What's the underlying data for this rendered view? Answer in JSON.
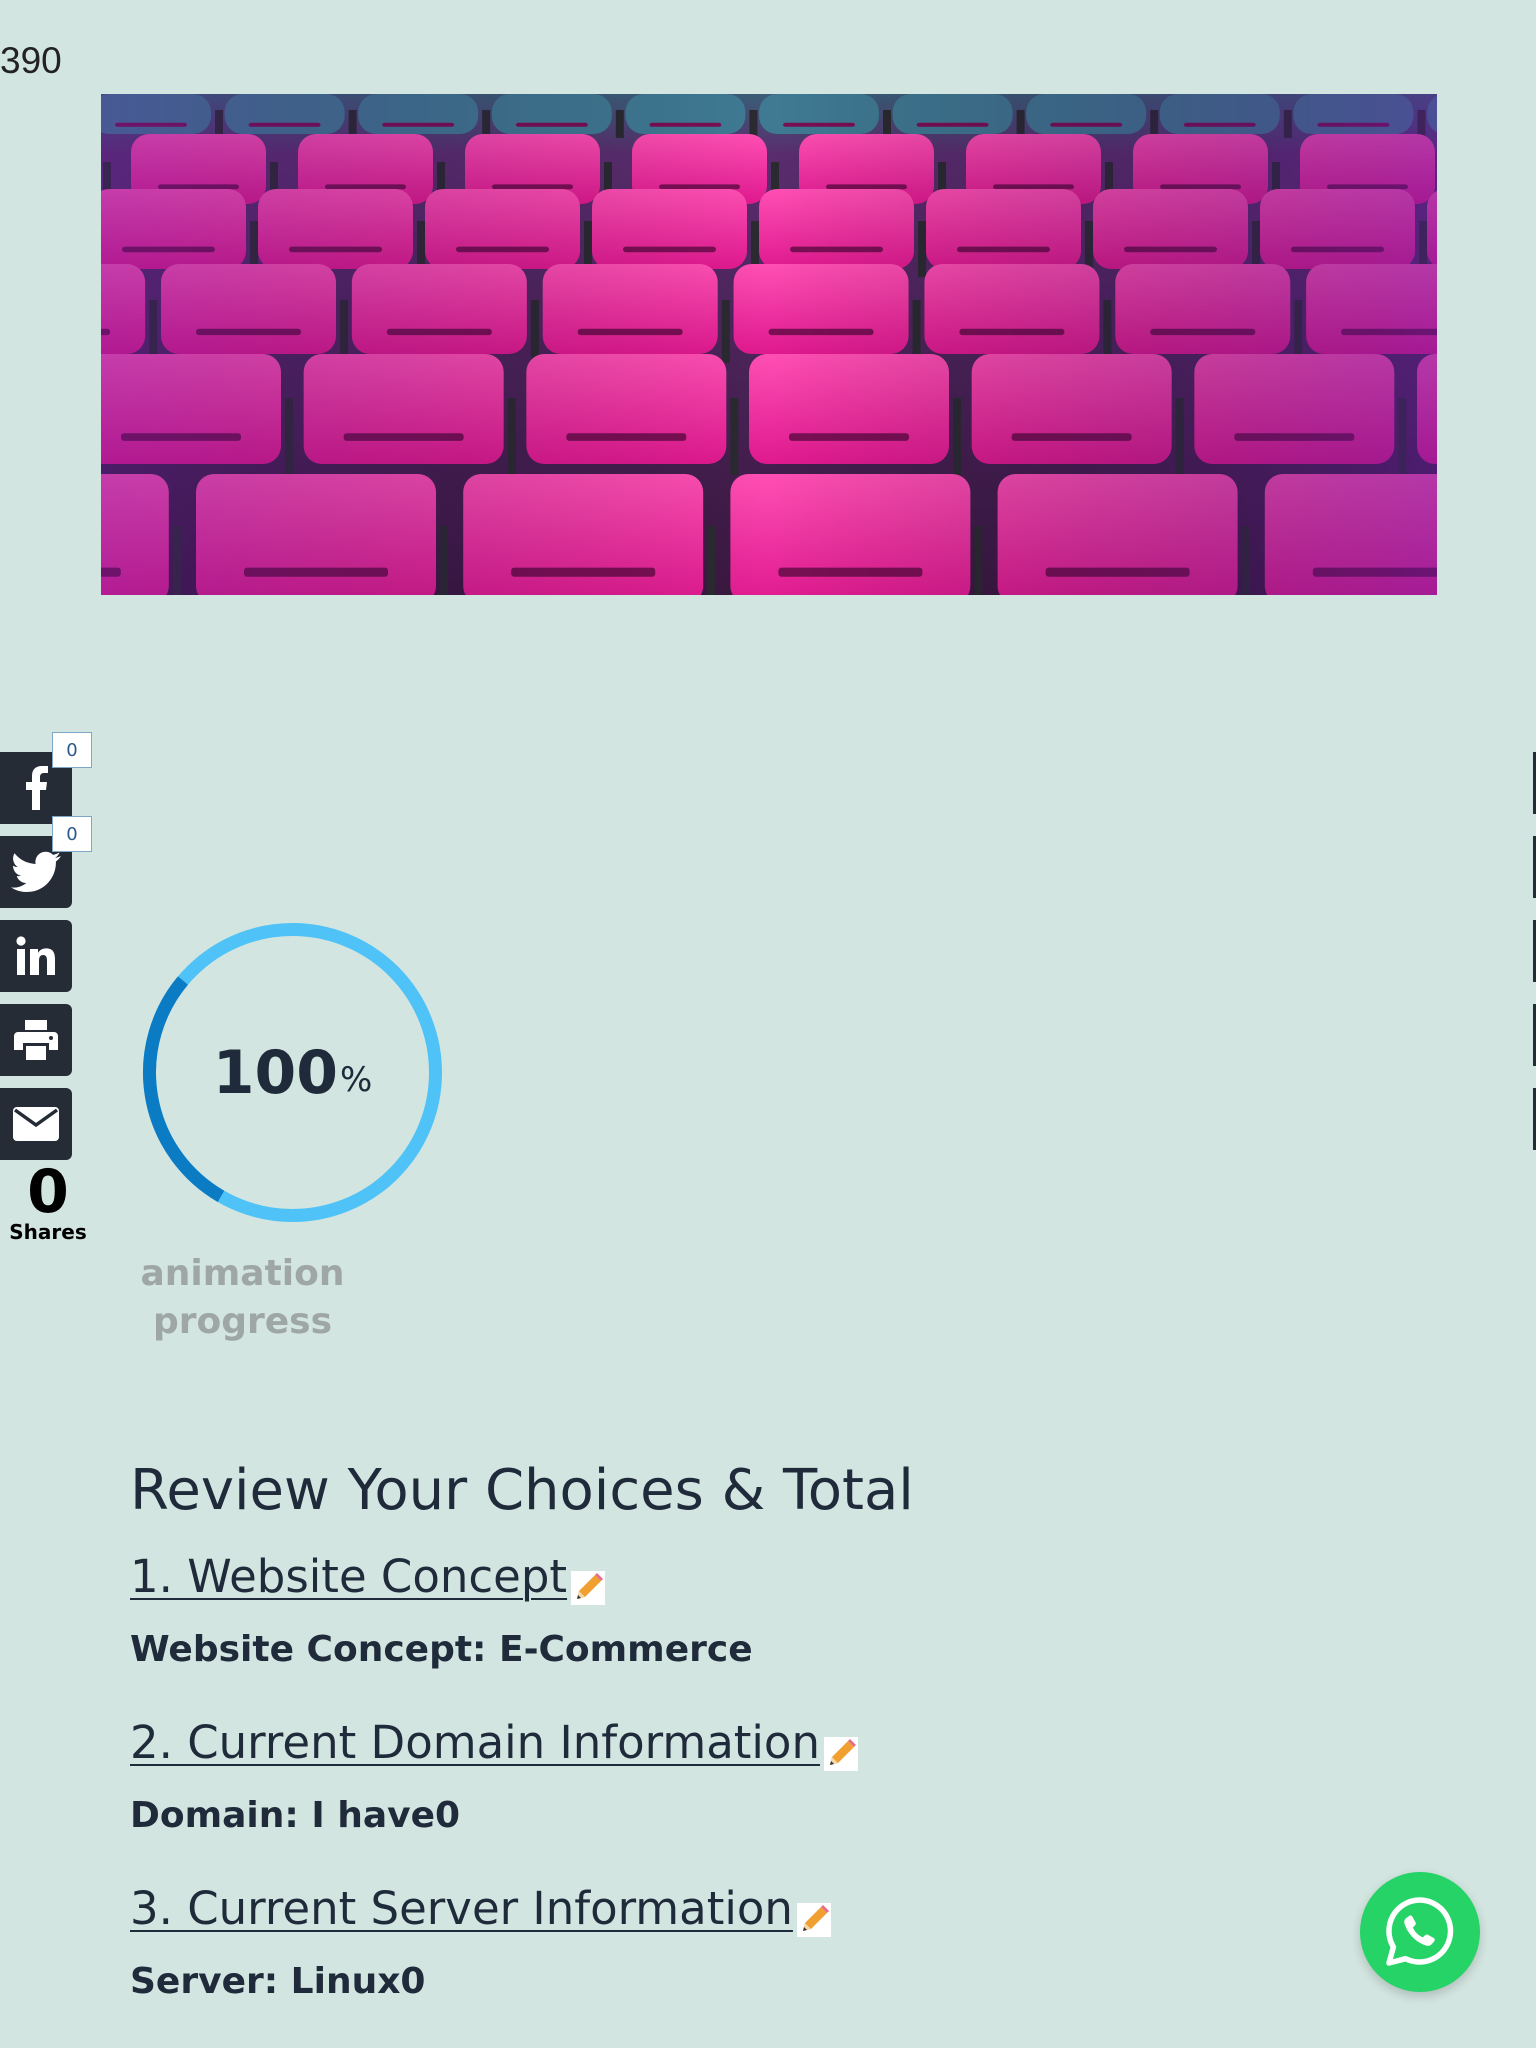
{
  "counter": "390",
  "hero": {
    "image": "pink-stadium-seats-photo"
  },
  "share": {
    "facebook": {
      "icon": "facebook-icon",
      "count": "0"
    },
    "twitter": {
      "icon": "twitter-icon",
      "count": "0"
    },
    "linkedin": {
      "icon": "linkedin-icon"
    },
    "print": {
      "icon": "print-icon"
    },
    "email": {
      "icon": "email-icon"
    },
    "total": "0",
    "total_label": "Shares"
  },
  "progress": {
    "value": "100",
    "unit": "%",
    "caption_line1": "animation",
    "caption_line2": "progress",
    "colors": {
      "light": "#4fc3f7",
      "dark": "#0b7bc4"
    }
  },
  "review": {
    "title": "Review Your Choices & Total",
    "steps": [
      {
        "title": "1. Website Concept ",
        "value": "Website Concept: E-Commerce"
      },
      {
        "title": "2. Current Domain Information ",
        "value": "Domain: I have0"
      },
      {
        "title": "3. Current Server Information ",
        "value": "Server: Linux0"
      }
    ],
    "edit_icon": "pencil-icon"
  },
  "whatsapp": {
    "icon": "whatsapp-icon",
    "color": "#25d366"
  }
}
